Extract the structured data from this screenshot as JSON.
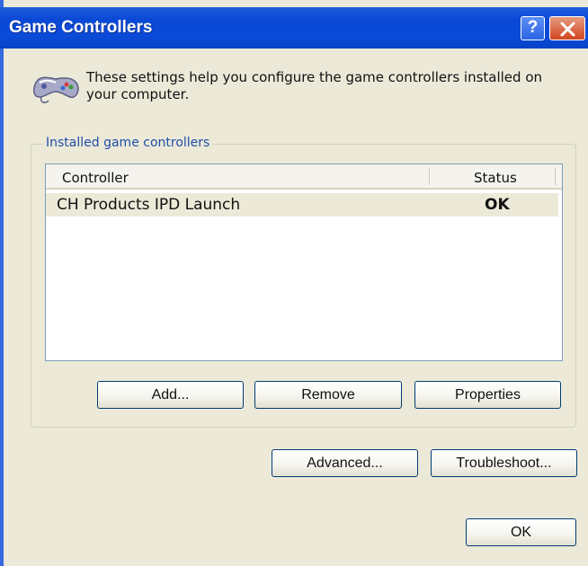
{
  "window": {
    "title": "Game Controllers",
    "help_glyph": "?"
  },
  "info": {
    "icon": "gamepad-icon",
    "text": "These settings help you configure the game controllers installed on your computer."
  },
  "group": {
    "label": "Installed game controllers"
  },
  "list": {
    "columns": [
      "Controller",
      "Status"
    ],
    "rows": [
      {
        "name": "CH Products IPD Launch",
        "status": "OK"
      }
    ]
  },
  "buttons": {
    "add": "Add...",
    "remove": "Remove",
    "properties": "Properties",
    "advanced": "Advanced...",
    "troubleshoot": "Troubleshoot...",
    "ok": "OK"
  },
  "colors": {
    "titlebar": "#0a48d6",
    "dialog_bg": "#ece9d8",
    "group_label": "#1f4ea8",
    "close_button": "#d0461f"
  }
}
